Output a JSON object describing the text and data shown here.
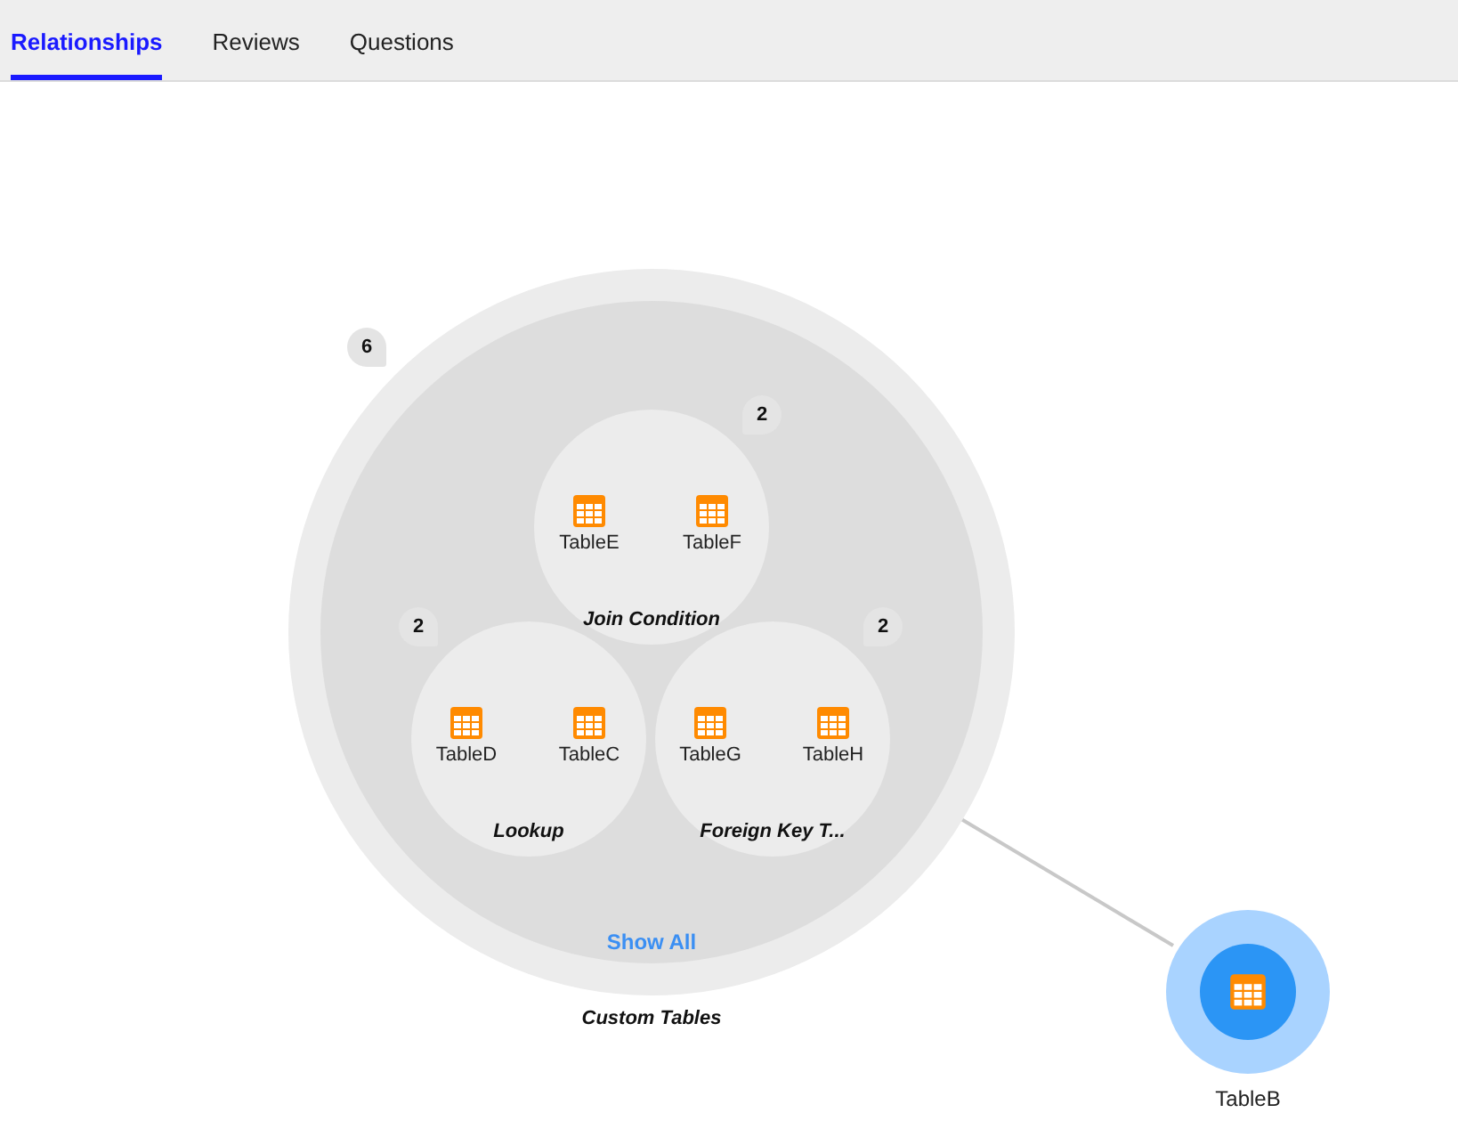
{
  "tabs": [
    {
      "label": "Relationships",
      "selected": true
    },
    {
      "label": "Reviews",
      "selected": false
    },
    {
      "label": "Questions",
      "selected": false
    }
  ],
  "diagram": {
    "group": {
      "label": "Custom Tables",
      "count": "6",
      "action": "Show All"
    },
    "subgroups": [
      {
        "label": "Join Condition",
        "count": "2",
        "tables": [
          {
            "name": "TableE"
          },
          {
            "name": "TableF"
          }
        ]
      },
      {
        "label": "Lookup",
        "count": "2",
        "tables": [
          {
            "name": "TableD"
          },
          {
            "name": "TableC"
          }
        ]
      },
      {
        "label": "Foreign Key T...",
        "count": "2",
        "tables": [
          {
            "name": "TableG"
          },
          {
            "name": "TableH"
          }
        ]
      }
    ],
    "target": {
      "name": "TableB"
    }
  }
}
